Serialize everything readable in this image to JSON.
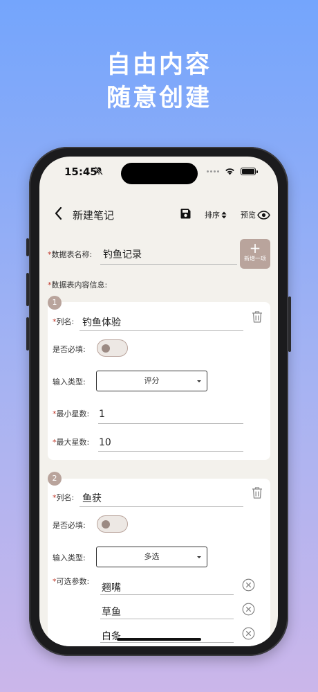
{
  "hero": {
    "line1": "自由内容",
    "line2": "随意创建"
  },
  "status": {
    "time": "15:45"
  },
  "nav": {
    "title": "新建笔记",
    "sort_label": "排序",
    "preview_label": "预览"
  },
  "table": {
    "name_label": "数据表名称:",
    "name_value": "钓鱼记录",
    "add_label": "新增一项",
    "content_label": "数据表内容信息:",
    "required_mark": "*"
  },
  "items": [
    {
      "index": "1",
      "col_label": "列名:",
      "col_value": "钓鱼体验",
      "required_label": "是否必填:",
      "required_on": false,
      "type_label": "输入类型:",
      "type_value": "评分",
      "min_label": "最小星数:",
      "min_value": "1",
      "max_label": "最大星数:",
      "max_value": "10"
    },
    {
      "index": "2",
      "col_label": "列名:",
      "col_value": "鱼获",
      "required_label": "是否必填:",
      "required_on": false,
      "type_label": "输入类型:",
      "type_value": "多选",
      "options_label": "可选参数:",
      "options": [
        "翘嘴",
        "草鱼",
        "白条"
      ]
    }
  ],
  "colors": {
    "accent": "#b9a49c",
    "background": "#f3f1ec",
    "required_star": "#c0392b"
  }
}
